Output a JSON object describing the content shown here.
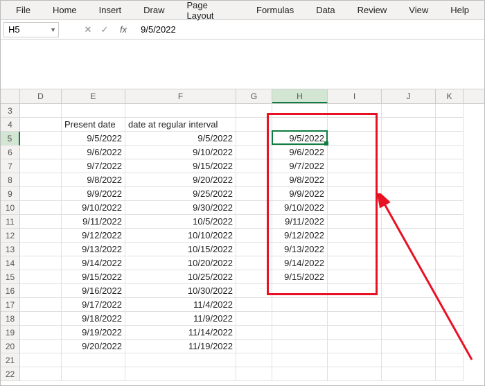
{
  "ribbon": [
    "File",
    "Home",
    "Insert",
    "Draw",
    "Page Layout",
    "Formulas",
    "Data",
    "Review",
    "View",
    "Help"
  ],
  "namebox": "H5",
  "formula": "9/5/2022",
  "cols": [
    "D",
    "E",
    "F",
    "G",
    "H",
    "I",
    "J",
    "K"
  ],
  "rows": [
    "3",
    "4",
    "5",
    "6",
    "7",
    "8",
    "9",
    "10",
    "11",
    "12",
    "13",
    "14",
    "15",
    "16",
    "17",
    "18",
    "19",
    "20",
    "21",
    "22"
  ],
  "headerE": "Present date",
  "headerF": "date at regular interval",
  "E": [
    "9/5/2022",
    "9/6/2022",
    "9/7/2022",
    "9/8/2022",
    "9/9/2022",
    "9/10/2022",
    "9/11/2022",
    "9/12/2022",
    "9/13/2022",
    "9/14/2022",
    "9/15/2022",
    "9/16/2022",
    "9/17/2022",
    "9/18/2022",
    "9/19/2022",
    "9/20/2022"
  ],
  "F": [
    "9/5/2022",
    "9/10/2022",
    "9/15/2022",
    "9/20/2022",
    "9/25/2022",
    "9/30/2022",
    "10/5/2022",
    "10/10/2022",
    "10/15/2022",
    "10/20/2022",
    "10/25/2022",
    "10/30/2022",
    "11/4/2022",
    "11/9/2022",
    "11/14/2022",
    "11/19/2022"
  ],
  "H": [
    "9/5/2022",
    "9/6/2022",
    "9/7/2022",
    "9/8/2022",
    "9/9/2022",
    "9/10/2022",
    "9/11/2022",
    "9/12/2022",
    "9/13/2022",
    "9/14/2022",
    "9/15/2022"
  ],
  "fx": {
    "cancel": "✕",
    "enter": "✓",
    "fx": "fx"
  }
}
